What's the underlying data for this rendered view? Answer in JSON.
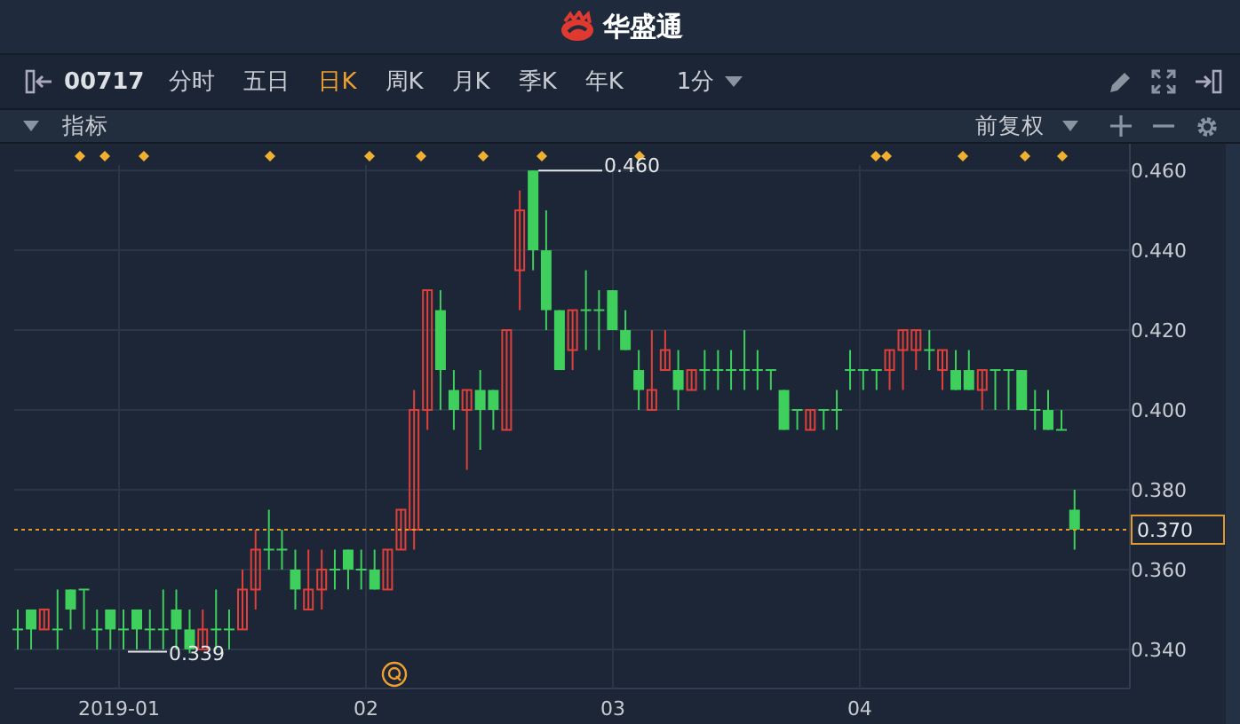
{
  "header": {
    "title": "华盛通"
  },
  "toolbar": {
    "code": "00717",
    "tabs": [
      {
        "label": "分时",
        "selected": false
      },
      {
        "label": "五日",
        "selected": false
      },
      {
        "label": "日K",
        "selected": true
      },
      {
        "label": "周K",
        "selected": false
      },
      {
        "label": "月K",
        "selected": false
      },
      {
        "label": "季K",
        "selected": false
      },
      {
        "label": "年K",
        "selected": false
      }
    ],
    "interval": "1分"
  },
  "indicator_bar": {
    "label": "指标",
    "adjustment": "前复权"
  },
  "chart": {
    "high_label": "0.460",
    "low_label": "0.339",
    "chart_data": {
      "type": "candlestick",
      "x": [
        0.59,
        0.644,
        0.697,
        0.751,
        0.804,
        0.858,
        0.911,
        0.965,
        1.018,
        1.072,
        1.125,
        1.179,
        1.232,
        1.286,
        1.339,
        1.393,
        1.446,
        1.5,
        1.553,
        1.607,
        1.66,
        1.714,
        1.767,
        1.821,
        1.874,
        1.928,
        1.981,
        2.035,
        2.088,
        2.142,
        2.195,
        2.249,
        2.302,
        2.356,
        2.409,
        2.463,
        2.516,
        2.57,
        2.623,
        2.677,
        2.73,
        2.784,
        2.837,
        2.891,
        2.944,
        2.998,
        3.051,
        3.105,
        3.158,
        3.212,
        3.265,
        3.319,
        3.372,
        3.426,
        3.479,
        3.533,
        3.586,
        3.64,
        3.693,
        3.747,
        3.8,
        3.854,
        3.907,
        3.961,
        4.014,
        4.068,
        4.121,
        4.175,
        4.228,
        4.282,
        4.335,
        4.389,
        4.442,
        4.496,
        4.549,
        4.603,
        4.656,
        4.71,
        4.763,
        4.817,
        4.87
      ],
      "ohlc": [
        [
          0.345,
          0.35,
          0.34,
          0.345
        ],
        [
          0.35,
          0.35,
          0.34,
          0.345
        ],
        [
          0.345,
          0.35,
          0.345,
          0.35
        ],
        [
          0.345,
          0.355,
          0.34,
          0.345
        ],
        [
          0.355,
          0.355,
          0.345,
          0.35
        ],
        [
          0.355,
          0.355,
          0.345,
          0.355
        ],
        [
          0.345,
          0.35,
          0.34,
          0.345
        ],
        [
          0.35,
          0.35,
          0.34,
          0.345
        ],
        [
          0.345,
          0.35,
          0.34,
          0.345
        ],
        [
          0.35,
          0.35,
          0.34,
          0.345
        ],
        [
          0.345,
          0.35,
          0.34,
          0.345
        ],
        [
          0.345,
          0.355,
          0.34,
          0.345
        ],
        [
          0.35,
          0.355,
          0.34,
          0.345
        ],
        [
          0.345,
          0.35,
          0.339,
          0.34
        ],
        [
          0.34,
          0.35,
          0.34,
          0.345
        ],
        [
          0.345,
          0.355,
          0.34,
          0.345
        ],
        [
          0.345,
          0.35,
          0.34,
          0.345
        ],
        [
          0.345,
          0.36,
          0.345,
          0.355
        ],
        [
          0.355,
          0.37,
          0.35,
          0.365
        ],
        [
          0.365,
          0.375,
          0.36,
          0.365
        ],
        [
          0.365,
          0.37,
          0.36,
          0.365
        ],
        [
          0.36,
          0.365,
          0.35,
          0.355
        ],
        [
          0.35,
          0.365,
          0.35,
          0.355
        ],
        [
          0.355,
          0.365,
          0.35,
          0.36
        ],
        [
          0.36,
          0.365,
          0.355,
          0.36
        ],
        [
          0.365,
          0.365,
          0.355,
          0.36
        ],
        [
          0.36,
          0.365,
          0.355,
          0.36
        ],
        [
          0.36,
          0.365,
          0.355,
          0.355
        ],
        [
          0.355,
          0.365,
          0.355,
          0.365
        ],
        [
          0.365,
          0.375,
          0.365,
          0.375
        ],
        [
          0.37,
          0.405,
          0.365,
          0.4
        ],
        [
          0.4,
          0.43,
          0.395,
          0.43
        ],
        [
          0.425,
          0.43,
          0.4,
          0.41
        ],
        [
          0.405,
          0.41,
          0.395,
          0.4
        ],
        [
          0.4,
          0.405,
          0.385,
          0.405
        ],
        [
          0.405,
          0.41,
          0.39,
          0.4
        ],
        [
          0.405,
          0.405,
          0.395,
          0.4
        ],
        [
          0.395,
          0.42,
          0.395,
          0.42
        ],
        [
          0.435,
          0.455,
          0.425,
          0.45
        ],
        [
          0.46,
          0.46,
          0.435,
          0.44
        ],
        [
          0.44,
          0.45,
          0.42,
          0.425
        ],
        [
          0.425,
          0.425,
          0.41,
          0.41
        ],
        [
          0.415,
          0.425,
          0.41,
          0.425
        ],
        [
          0.425,
          0.435,
          0.415,
          0.425
        ],
        [
          0.425,
          0.43,
          0.415,
          0.425
        ],
        [
          0.43,
          0.43,
          0.42,
          0.42
        ],
        [
          0.42,
          0.425,
          0.415,
          0.415
        ],
        [
          0.41,
          0.415,
          0.4,
          0.405
        ],
        [
          0.4,
          0.42,
          0.4,
          0.405
        ],
        [
          0.41,
          0.42,
          0.41,
          0.415
        ],
        [
          0.41,
          0.415,
          0.4,
          0.405
        ],
        [
          0.405,
          0.41,
          0.405,
          0.41
        ],
        [
          0.41,
          0.415,
          0.405,
          0.41
        ],
        [
          0.41,
          0.415,
          0.405,
          0.41
        ],
        [
          0.41,
          0.415,
          0.405,
          0.41
        ],
        [
          0.41,
          0.42,
          0.405,
          0.41
        ],
        [
          0.41,
          0.415,
          0.405,
          0.41
        ],
        [
          0.41,
          0.41,
          0.405,
          0.41
        ],
        [
          0.405,
          0.405,
          0.395,
          0.395
        ],
        [
          0.4,
          0.4,
          0.395,
          0.4
        ],
        [
          0.395,
          0.4,
          0.395,
          0.4
        ],
        [
          0.4,
          0.4,
          0.395,
          0.4
        ],
        [
          0.4,
          0.405,
          0.395,
          0.4
        ],
        [
          0.41,
          0.415,
          0.405,
          0.41
        ],
        [
          0.41,
          0.41,
          0.405,
          0.41
        ],
        [
          0.41,
          0.41,
          0.405,
          0.41
        ],
        [
          0.41,
          0.415,
          0.405,
          0.415
        ],
        [
          0.415,
          0.42,
          0.405,
          0.42
        ],
        [
          0.415,
          0.42,
          0.41,
          0.42
        ],
        [
          0.415,
          0.42,
          0.41,
          0.415
        ],
        [
          0.41,
          0.415,
          0.405,
          0.415
        ],
        [
          0.41,
          0.415,
          0.405,
          0.405
        ],
        [
          0.41,
          0.415,
          0.405,
          0.405
        ],
        [
          0.405,
          0.41,
          0.4,
          0.41
        ],
        [
          0.41,
          0.41,
          0.4,
          0.41
        ],
        [
          0.41,
          0.41,
          0.4,
          0.41
        ],
        [
          0.41,
          0.41,
          0.4,
          0.4
        ],
        [
          0.4,
          0.405,
          0.395,
          0.4
        ],
        [
          0.4,
          0.405,
          0.395,
          0.395
        ],
        [
          0.395,
          0.4,
          0.395,
          0.395
        ],
        [
          0.375,
          0.38,
          0.365,
          0.37
        ]
      ],
      "yticks": [
        {
          "value": 0.46,
          "label": "0.460"
        },
        {
          "value": 0.44,
          "label": "0.440"
        },
        {
          "value": 0.42,
          "label": "0.420"
        },
        {
          "value": 0.4,
          "label": "0.400"
        },
        {
          "value": 0.38,
          "label": "0.380"
        },
        {
          "value": 0.36,
          "label": "0.360"
        },
        {
          "value": 0.34,
          "label": "0.340"
        }
      ],
      "xticks": [
        {
          "value": 1,
          "label": "2019-01"
        },
        {
          "value": 2,
          "label": "02"
        },
        {
          "value": 3,
          "label": "03"
        },
        {
          "value": 4,
          "label": "04"
        }
      ],
      "xlim": [
        0.5755,
        5.094
      ],
      "ylim": [
        0.3302,
        0.4667
      ],
      "grid": true,
      "ref_lines": [
        {
          "axis": "y",
          "value": 0.37,
          "label": "0.370"
        }
      ]
    }
  }
}
